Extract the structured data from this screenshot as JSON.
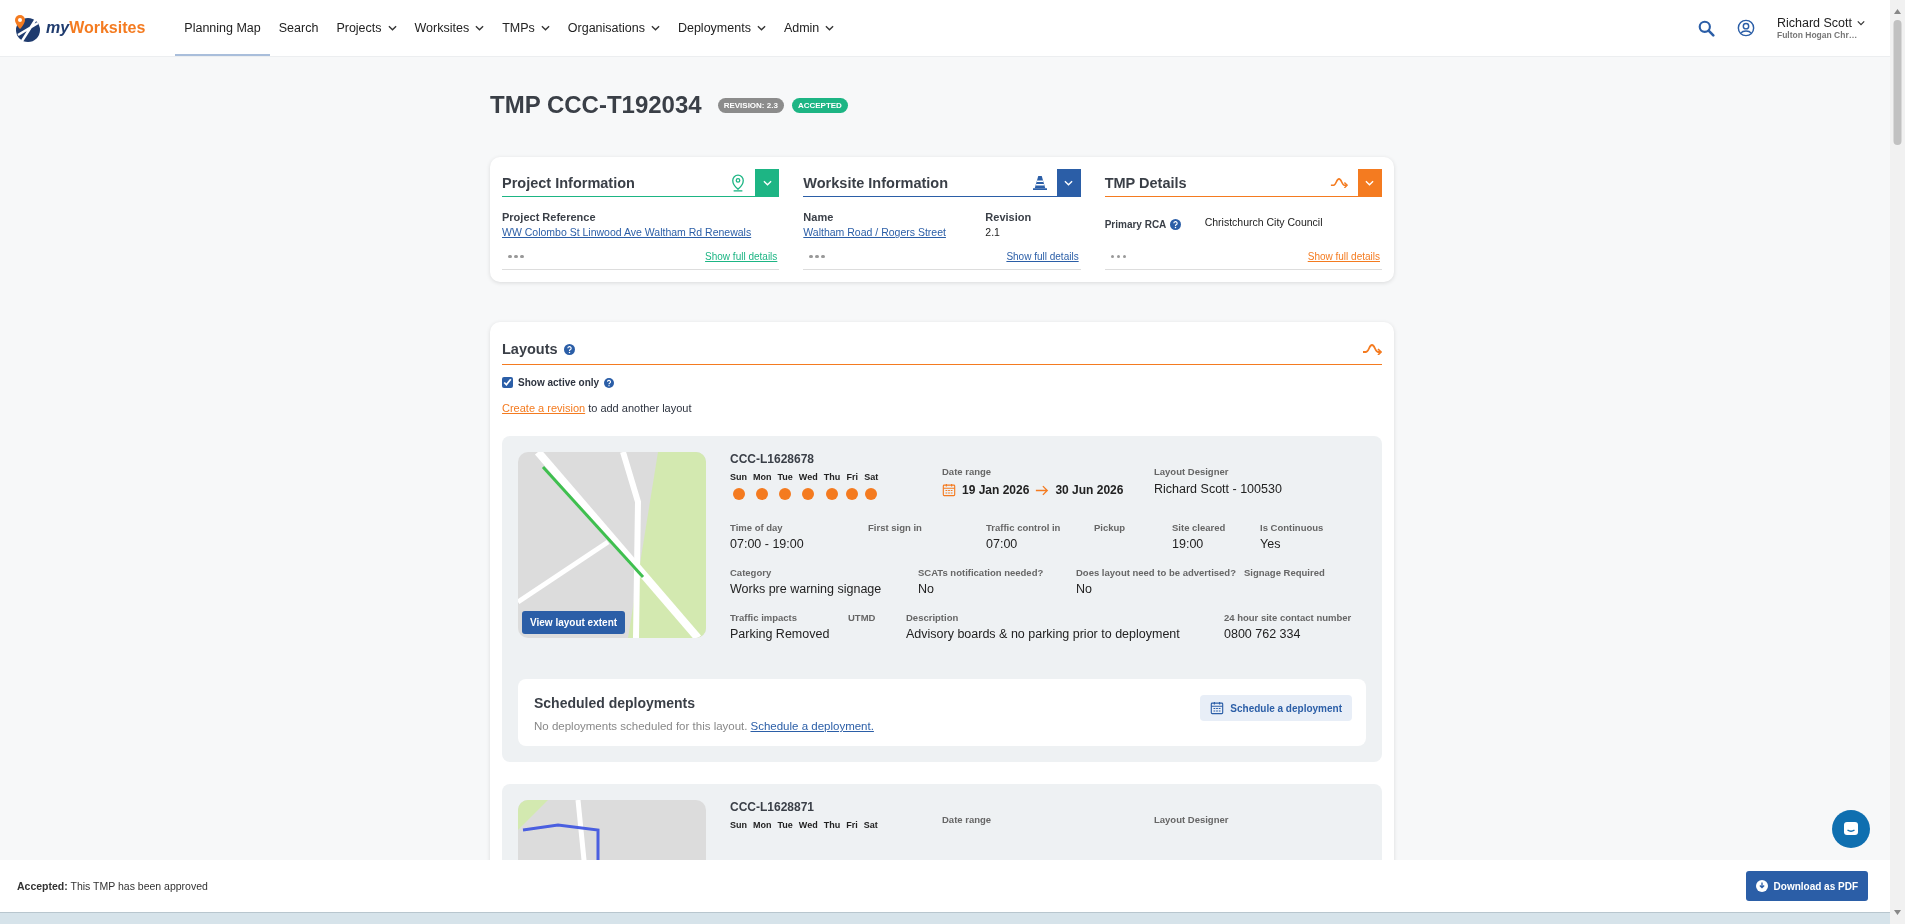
{
  "header": {
    "logo": {
      "prefix": "my",
      "name": "Worksites"
    },
    "nav": [
      {
        "label": "Planning Map",
        "selected": true,
        "dropdown": false
      },
      {
        "label": "Search",
        "selected": false,
        "dropdown": false
      },
      {
        "label": "Projects",
        "selected": false,
        "dropdown": true
      },
      {
        "label": "Worksites",
        "selected": false,
        "dropdown": true
      },
      {
        "label": "TMPs",
        "selected": false,
        "dropdown": true
      },
      {
        "label": "Organisations",
        "selected": false,
        "dropdown": true
      },
      {
        "label": "Deployments",
        "selected": false,
        "dropdown": true
      },
      {
        "label": "Admin",
        "selected": false,
        "dropdown": true
      }
    ],
    "user": {
      "name": "Richard Scott",
      "organisation": "Fulton Hogan Chr…"
    }
  },
  "page": {
    "title": "TMP CCC-T192034",
    "badges": [
      {
        "label": "REVISION: 2.3",
        "color": "#8c8c8c"
      },
      {
        "label": "ACCEPTED",
        "color": "#1db584"
      }
    ]
  },
  "info_sections": [
    {
      "title": "Project Information",
      "color": "#1db584",
      "kind": "stacked",
      "fields": [
        {
          "label": "Project Reference",
          "value": "WW Colombo St Linwood Ave Waltham Rd Renewals",
          "link": true
        }
      ],
      "details_link": "Show full details"
    },
    {
      "title": "Worksite Information",
      "color": "#2b5ea7",
      "kind": "stacked",
      "fields": [
        {
          "label": "Name",
          "value": "Waltham Road / Rogers Street",
          "link": true
        },
        {
          "label": "Revision",
          "value": "2.1",
          "link": false
        }
      ],
      "details_link": "Show full details"
    },
    {
      "title": "TMP Details",
      "color": "#f47b20",
      "kind": "inline",
      "fields": [
        {
          "label": "Primary RCA",
          "value": "Christchurch City Council",
          "link": false,
          "help": true
        }
      ],
      "details_link": "Show full details"
    }
  ],
  "layouts": {
    "title": "Layouts",
    "show_active_only": {
      "label": "Show active only",
      "checked": true
    },
    "create_link": "Create a revision",
    "create_text": "to add another layout",
    "items": [
      {
        "id": "CCC-L1628678",
        "color": "#3fbf4f",
        "map_button": "View layout extent",
        "days": [
          {
            "label": "Sun",
            "active": true
          },
          {
            "label": "Mon",
            "active": true
          },
          {
            "label": "Tue",
            "active": true
          },
          {
            "label": "Wed",
            "active": true
          },
          {
            "label": "Thu",
            "active": true
          },
          {
            "label": "Fri",
            "active": true
          },
          {
            "label": "Sat",
            "active": true
          }
        ],
        "date_range": {
          "label": "Date range",
          "start": "19 Jan 2026",
          "end": "30 Jun 2026"
        },
        "designer": {
          "label": "Layout Designer",
          "value": "Richard Scott - 100530"
        },
        "field_rows": [
          [
            {
              "label": "Time of day",
              "value": "07:00 - 19:00"
            },
            {
              "label": "First sign in"
            },
            {
              "label": "Traffic control in",
              "value": "07:00"
            },
            {
              "label": "Pickup"
            },
            {
              "label": "Site cleared",
              "value": "19:00"
            },
            {
              "label": "Is Continuous",
              "value": "Yes"
            }
          ],
          [
            {
              "label": "Category",
              "value": "Works pre warning signage"
            },
            {
              "label": "SCATs notification needed?",
              "value": "No"
            },
            {
              "label": "Does layout need to be advertised?",
              "value": "No"
            },
            {
              "label": "Signage Required"
            }
          ],
          [
            {
              "label": "Traffic impacts",
              "value": "Parking Removed"
            },
            {
              "label": "UTMD"
            },
            {
              "label": "Description",
              "value": "Advisory boards & no parking prior to deployment"
            },
            {
              "label": "24 hour site contact number",
              "value": "0800 762 334"
            }
          ]
        ],
        "deployments": {
          "title": "Scheduled deployments",
          "empty_text": "No deployments scheduled for this layout.",
          "link": "Schedule a deployment.",
          "button": "Schedule a deployment"
        }
      },
      {
        "id": "CCC-L1628871",
        "color": "#4a5fe0",
        "days": [
          {
            "label": "Sun"
          },
          {
            "label": "Mon"
          },
          {
            "label": "Tue"
          },
          {
            "label": "Wed"
          },
          {
            "label": "Thu"
          },
          {
            "label": "Fri"
          },
          {
            "label": "Sat"
          }
        ],
        "date_range": {
          "label": "Date range"
        },
        "designer": {
          "label": "Layout Designer"
        }
      }
    ]
  },
  "footer": {
    "status": "**Accepted:** This TMP has been approved",
    "button": "Download as PDF"
  }
}
